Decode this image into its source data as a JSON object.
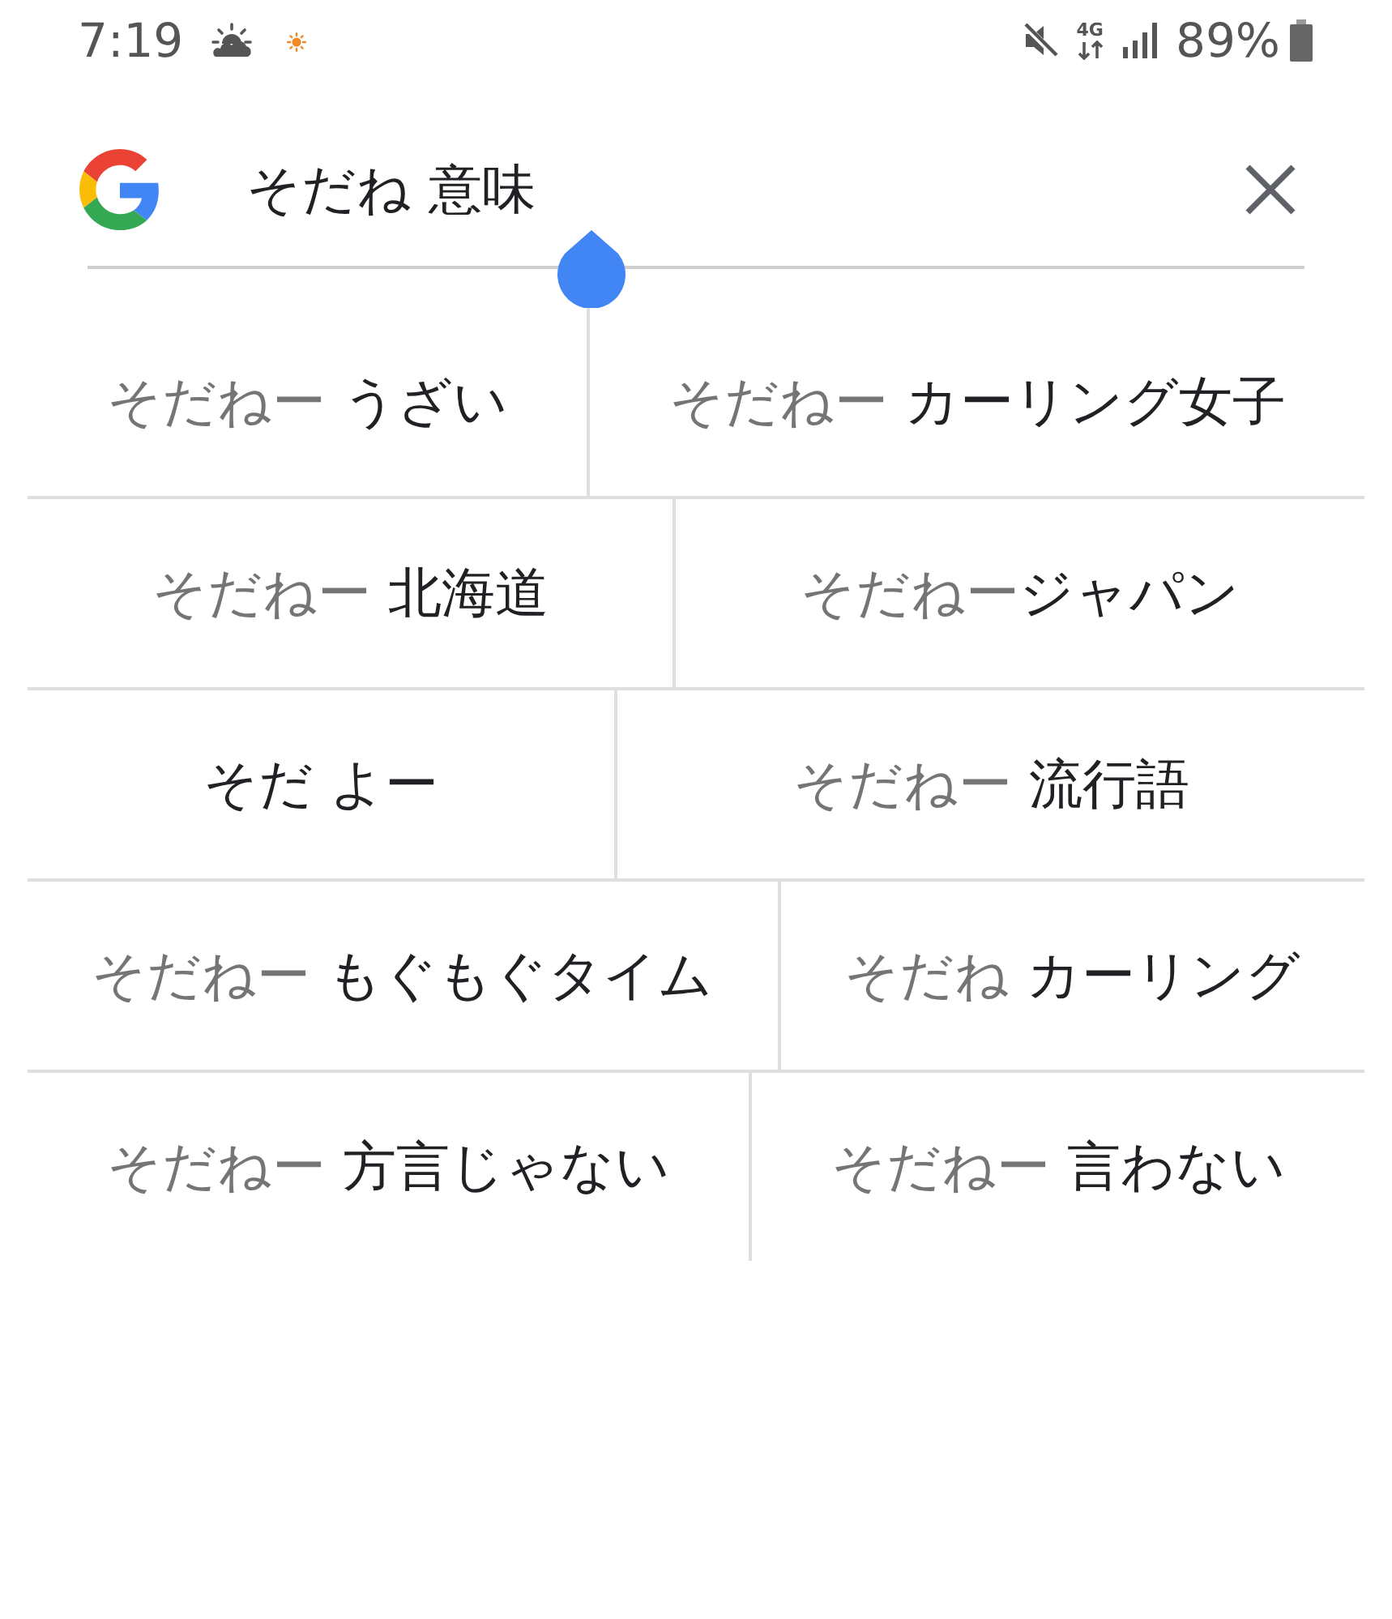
{
  "status_bar": {
    "time": "7:19",
    "network": "4G",
    "battery": "89%"
  },
  "search": {
    "query": "そだね 意味"
  },
  "suggestion_rows": [
    {
      "items": [
        {
          "prefix": "そだねー ",
          "completion": "うざい"
        },
        {
          "prefix": "そだねー ",
          "completion": "カーリング女子"
        }
      ]
    },
    {
      "items": [
        {
          "prefix": "そだねー ",
          "completion": "北海道"
        },
        {
          "prefix": "そだねー",
          "completion": "ジャパン"
        }
      ]
    },
    {
      "items": [
        {
          "completion": "そだ よー"
        },
        {
          "prefix": "そだねー ",
          "completion": "流行語"
        }
      ]
    },
    {
      "items": [
        {
          "prefix": "そだねー ",
          "completion": "もぐもぐタイム"
        },
        {
          "prefix": "そだね ",
          "completion": "カーリング"
        }
      ]
    },
    {
      "items": [
        {
          "prefix": "そだねー ",
          "completion": "方言じゃない"
        },
        {
          "prefix": "そだねー ",
          "completion": "言わない"
        }
      ]
    }
  ]
}
